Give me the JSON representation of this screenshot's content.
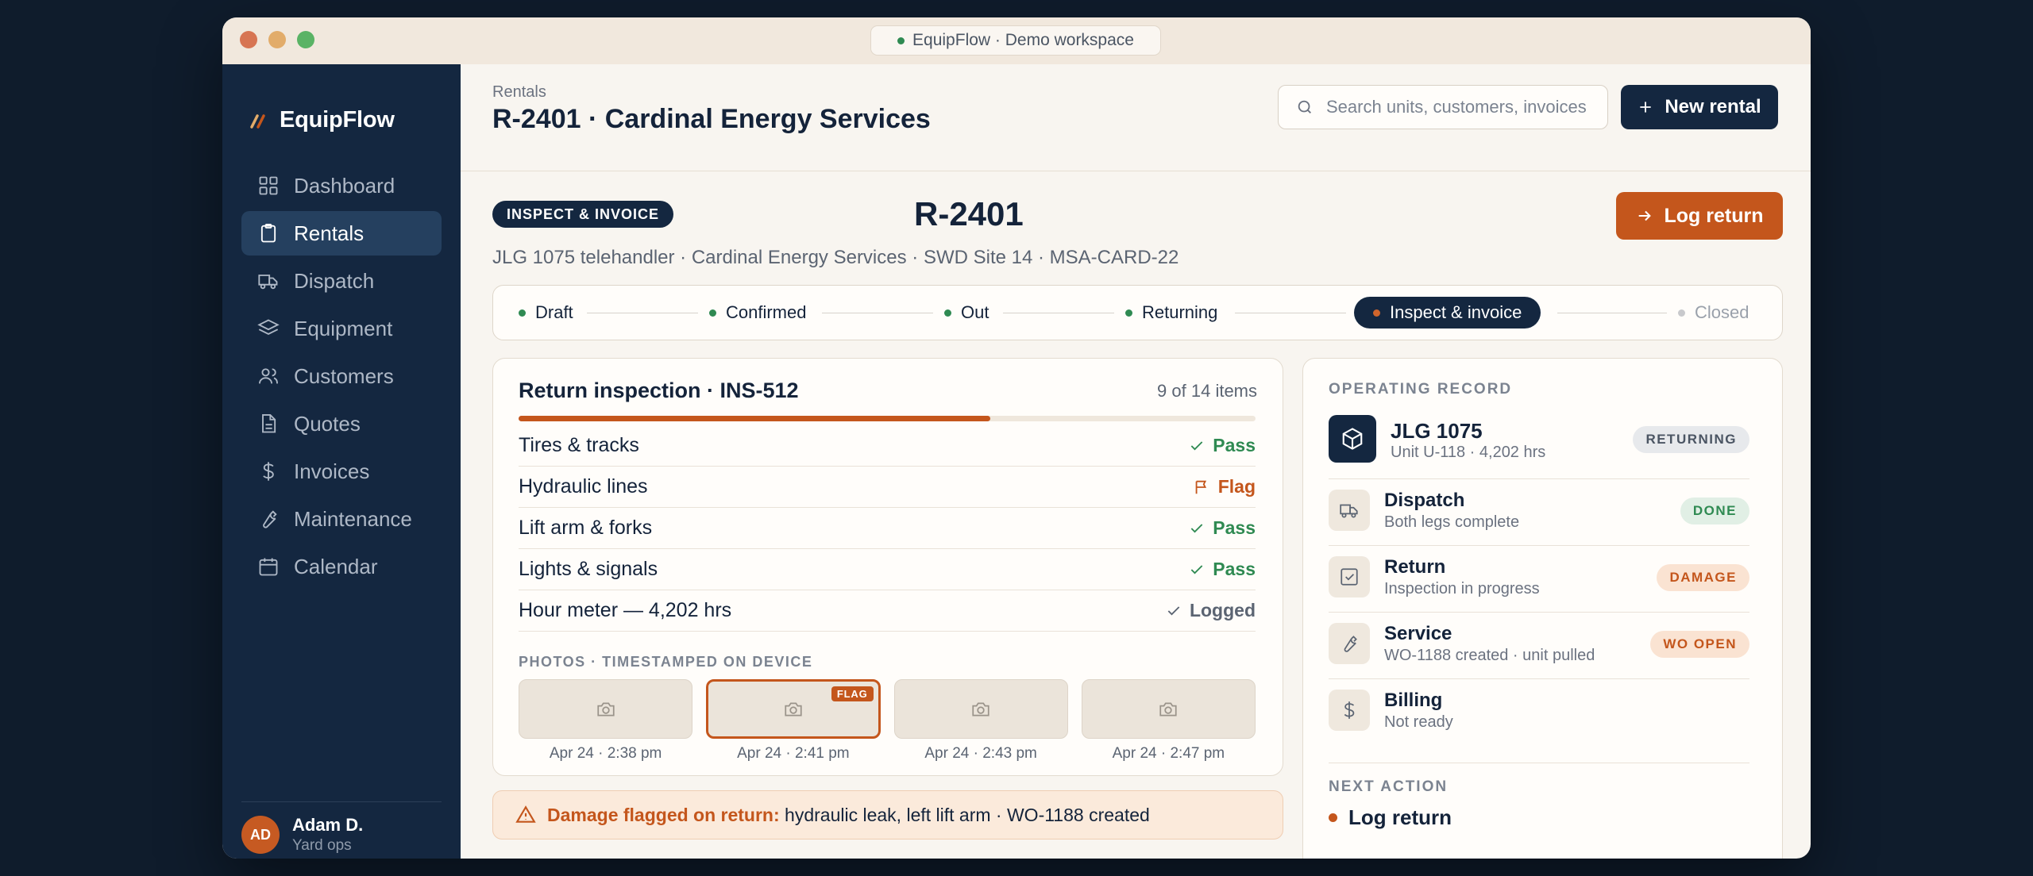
{
  "window": {
    "title": "EquipFlow · Demo workspace"
  },
  "sidebar": {
    "brand": "EquipFlow",
    "items": [
      {
        "label": "Dashboard",
        "icon": "grid-icon"
      },
      {
        "label": "Rentals",
        "icon": "clipboard-icon",
        "active": true
      },
      {
        "label": "Dispatch",
        "icon": "truck-icon"
      },
      {
        "label": "Equipment",
        "icon": "layers-icon"
      },
      {
        "label": "Customers",
        "icon": "users-icon"
      },
      {
        "label": "Quotes",
        "icon": "file-icon"
      },
      {
        "label": "Invoices",
        "icon": "dollar-icon"
      },
      {
        "label": "Maintenance",
        "icon": "wrench-icon"
      },
      {
        "label": "Calendar",
        "icon": "calendar-icon"
      }
    ],
    "user": {
      "initials": "AD",
      "name": "Adam D.",
      "role": "Yard ops"
    }
  },
  "header": {
    "breadcrumb": "Rentals",
    "title": "R-2401 · Cardinal Energy Services",
    "search_placeholder": "Search units, customers, invoices",
    "new_rental_label": "New rental"
  },
  "rental": {
    "stage_badge": "INSPECT & INVOICE",
    "id": "R-2401",
    "subtitle": "JLG 1075 telehandler · Cardinal Energy Services · SWD Site 14 · MSA-CARD-22",
    "log_return_label": "Log return"
  },
  "stepper": [
    {
      "label": "Draft",
      "state": "done"
    },
    {
      "label": "Confirmed",
      "state": "done"
    },
    {
      "label": "Out",
      "state": "done"
    },
    {
      "label": "Returning",
      "state": "done"
    },
    {
      "label": "Inspect & invoice",
      "state": "current"
    },
    {
      "label": "Closed",
      "state": "future"
    }
  ],
  "inspection": {
    "title": "Return inspection · INS-512",
    "count": "9 of 14 items",
    "progress": 0.64,
    "items": [
      {
        "label": "Tires & tracks",
        "result": "Pass",
        "status": "pass"
      },
      {
        "label": "Hydraulic lines",
        "result": "Flag",
        "status": "flag"
      },
      {
        "label": "Lift arm & forks",
        "result": "Pass",
        "status": "pass"
      },
      {
        "label": "Lights & signals",
        "result": "Pass",
        "status": "pass"
      },
      {
        "label": "Hour meter — 4,202 hrs",
        "result": "Logged",
        "status": "logged"
      }
    ],
    "photos_label": "PHOTOS · TIMESTAMPED ON DEVICE",
    "photos": [
      {
        "time": "Apr 24 · 2:38 pm",
        "flag": ""
      },
      {
        "time": "Apr 24 · 2:41 pm",
        "flag": "FLAG"
      },
      {
        "time": "Apr 24 · 2:43 pm",
        "flag": ""
      },
      {
        "time": "Apr 24 · 2:47 pm",
        "flag": ""
      }
    ]
  },
  "alert": {
    "strong": "Damage flagged on return:",
    "text": "hydraulic leak, left lift arm · WO-1188 created"
  },
  "operating_record": {
    "label": "OPERATING RECORD",
    "unit": {
      "name": "JLG 1075",
      "sub": "Unit U-118 · 4,202 hrs",
      "status": "RETURNING"
    },
    "rows": [
      {
        "title": "Dispatch",
        "sub": "Both legs complete",
        "status": "DONE",
        "tone": "green",
        "icon": "truck-icon"
      },
      {
        "title": "Return",
        "sub": "Inspection in progress",
        "status": "DAMAGE",
        "tone": "orange",
        "icon": "checkbox-icon"
      },
      {
        "title": "Service",
        "sub": "WO-1188 created · unit pulled",
        "status": "WO OPEN",
        "tone": "orange",
        "icon": "wrench-icon"
      },
      {
        "title": "Billing",
        "sub": "Not ready",
        "status": "",
        "tone": "",
        "icon": "dollar-icon"
      }
    ],
    "next_label": "NEXT ACTION",
    "next_action": "Log return"
  },
  "colors": {
    "navy": "#142740",
    "accent": "#c4561c",
    "success": "#2f8a52",
    "background": "#f8f5f0"
  }
}
